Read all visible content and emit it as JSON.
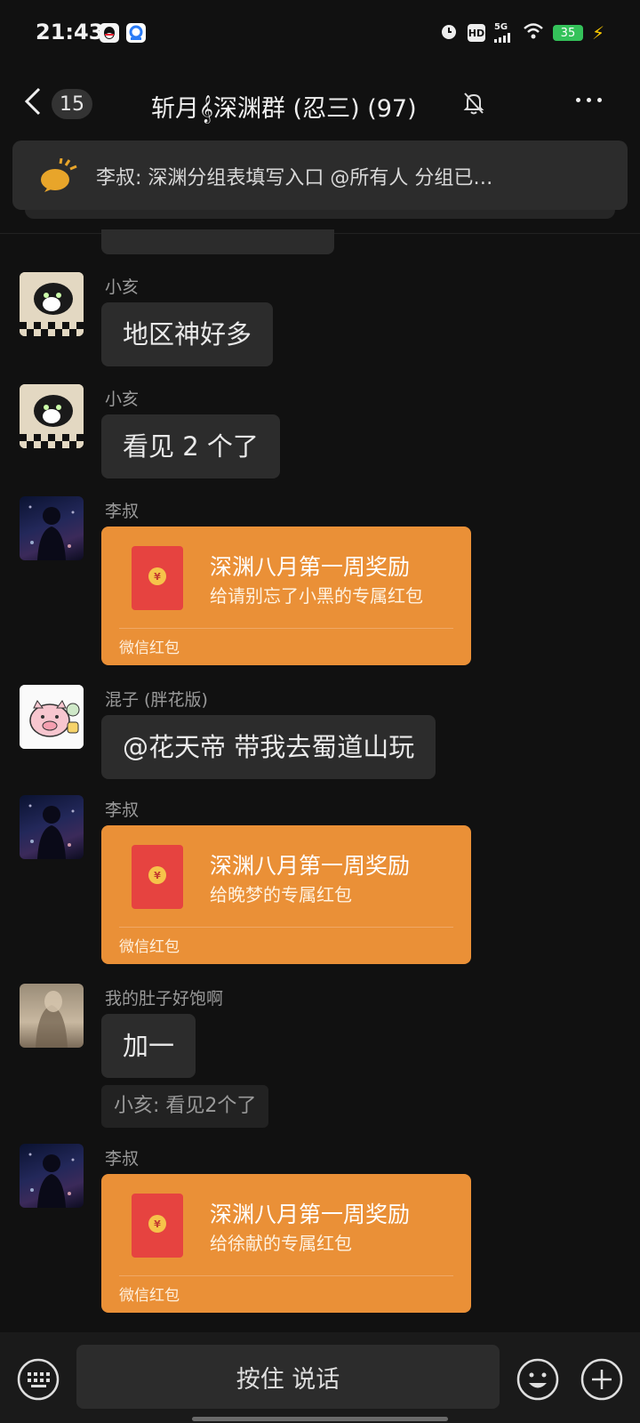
{
  "status_bar": {
    "time": "21:43",
    "network": "5G",
    "hd": "HD",
    "battery": "35"
  },
  "header": {
    "back_count": "15",
    "title": "斩月𝄞深渊群 (忍三) (97)"
  },
  "pinned": {
    "text": "李叔: 深渊分组表填写入口  @所有人       分组已…"
  },
  "messages": [
    {
      "sender": "小亥",
      "text": "地区神好多"
    },
    {
      "sender": "小亥",
      "text": "看见 2 个了"
    },
    {
      "sender": "李叔",
      "rp_title": "深渊八月第一周奖励",
      "rp_sub": "给请别忘了小黑的专属红包",
      "rp_foot": "微信红包"
    },
    {
      "sender": "混子 (胖花版)",
      "text": "@花天帝  带我去蜀道山玩"
    },
    {
      "sender": "李叔",
      "rp_title": "深渊八月第一周奖励",
      "rp_sub": "给晚梦的专属红包",
      "rp_foot": "微信红包"
    },
    {
      "sender": "我的肚子好饱啊",
      "text": "加一",
      "quote": "小亥: 看见2个了"
    },
    {
      "sender": "李叔",
      "rp_title": "深渊八月第一周奖励",
      "rp_sub": "给徐献的专属红包",
      "rp_foot": "微信红包"
    }
  ],
  "input": {
    "voice_label": "按住 说话"
  },
  "colors": {
    "background": "#111111",
    "bubble": "#2c2c2c",
    "red_packet": "#ea9037",
    "red_packet_icon": "#e64340"
  },
  "icons": [
    "back-icon",
    "mute-bell-icon",
    "more-icon",
    "megaphone-icon",
    "keyboard-icon",
    "emoji-icon",
    "plus-icon"
  ]
}
